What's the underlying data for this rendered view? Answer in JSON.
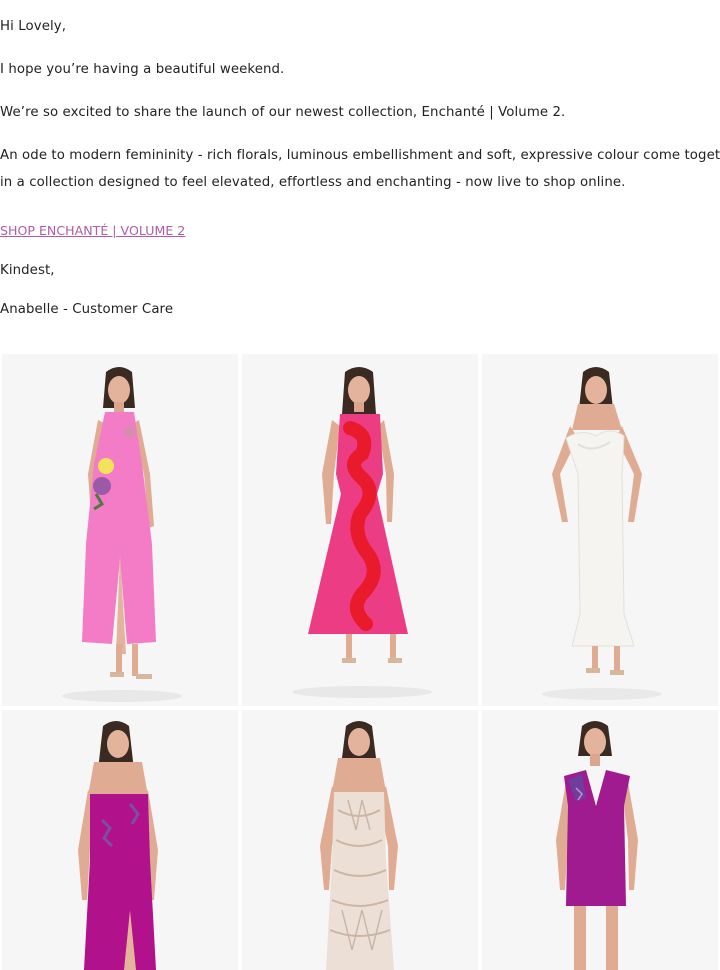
{
  "email": {
    "greeting": "Hi Lovely,",
    "line1": "I hope you’re having a beautiful weekend.",
    "line2": "We’re so excited to share the launch of our newest collection, Enchanté | Volume 2.",
    "paragraph_line1": "An ode to modern femininity - rich florals, luminous embellishment and soft, expressive colour come together",
    "paragraph_line2": "in a collection designed to feel elevated, effortless and enchanting - now live to shop online.",
    "cta_link": "SHOP ENCHANTÉ | VOLUME 2",
    "signoff": "Kindest,",
    "signature": "Anabelle - Customer Care"
  },
  "colors": {
    "link": "#b25aa7",
    "tile_bg": "#f6f6f6",
    "dress_pink": "#f47cc6",
    "dress_fuchsia": "#ec3d84",
    "dress_white": "#f5f4f0",
    "dress_magenta": "#b1118b",
    "dress_lace": "#ece0d6",
    "dress_purple": "#9f1b8f"
  },
  "products": [
    {
      "id": "p1",
      "icon": "pink-halter-dress-icon"
    },
    {
      "id": "p2",
      "icon": "fuchsia-floral-gown-icon"
    },
    {
      "id": "p3",
      "icon": "white-strapless-dress-icon"
    },
    {
      "id": "p4",
      "icon": "magenta-strapless-gown-icon"
    },
    {
      "id": "p5",
      "icon": "lace-strapless-gown-icon"
    },
    {
      "id": "p6",
      "icon": "purple-mini-dress-icon"
    }
  ]
}
